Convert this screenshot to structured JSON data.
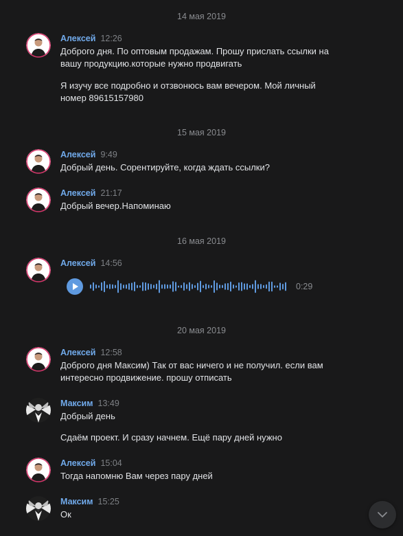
{
  "colors": {
    "background": "#19191a",
    "author": "#71aaeb",
    "text": "#e1e3e6",
    "muted": "#8a8c90",
    "accent": "#5f9ae0"
  },
  "dates": [
    "14 мая 2019",
    "15 мая 2019",
    "16 мая 2019",
    "20 мая 2019"
  ],
  "messages": [
    {
      "author": "Алексей",
      "time": "12:26",
      "avatar": "avatar-aleksey",
      "lines": [
        "Доброго дня. По оптовым продажам. Прошу прислать ссылки на",
        "вашу продукцию.которые нужно продвигать"
      ]
    },
    {
      "lines": [
        "Я изучу все подробно и отзвонюсь вам вечером. Мой личный",
        "номер 89615157980"
      ]
    },
    {
      "author": "Алексей",
      "time": "9:49",
      "avatar": "avatar-aleksey",
      "lines": [
        "Добрый день. Сорентируйте, когда ждать ссылки?"
      ]
    },
    {
      "author": "Алексей",
      "time": "21:17",
      "avatar": "avatar-aleksey",
      "lines": [
        "Добрый вечер.Напоминаю"
      ]
    },
    {
      "author": "Алексей",
      "time": "14:56",
      "avatar": "avatar-aleksey",
      "voice": {
        "duration": "0:29",
        "icon": "play-icon"
      }
    },
    {
      "author": "Алексей",
      "time": "12:58",
      "avatar": "avatar-aleksey",
      "lines": [
        "Доброго дня Максим) Так от вас ничего и не получил. если вам",
        "интересно продвижение. прошу отписать"
      ]
    },
    {
      "author": "Максим",
      "time": "13:49",
      "avatar": "avatar-maksim",
      "lines": [
        "Добрый день"
      ]
    },
    {
      "lines": [
        "Сдаём проект. И сразу начнем. Ещё пару дней нужно"
      ]
    },
    {
      "author": "Алексей",
      "time": "15:04",
      "avatar": "avatar-aleksey",
      "lines": [
        "Тогда напомню Вам через пару дней"
      ]
    },
    {
      "author": "Максим",
      "time": "15:25",
      "avatar": "avatar-maksim",
      "lines": [
        "Ок"
      ]
    }
  ],
  "scroll_button": {
    "icon": "chevron-down-icon"
  }
}
